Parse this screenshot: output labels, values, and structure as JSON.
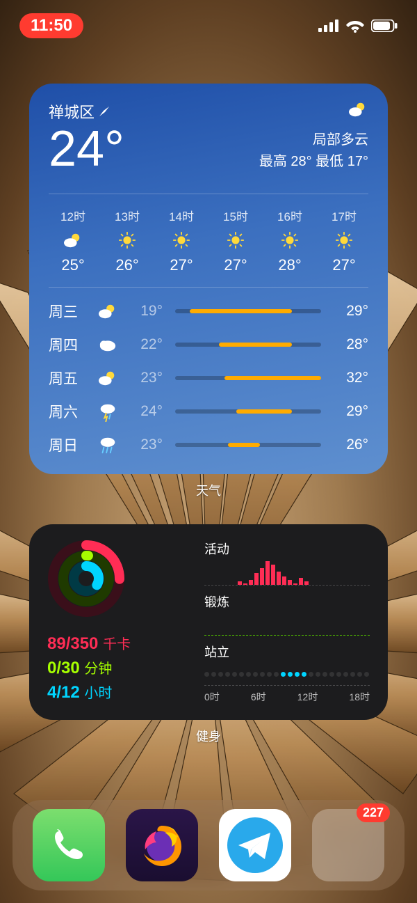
{
  "status": {
    "time": "11:50"
  },
  "weather_label": "天气",
  "fitness_label": "健身",
  "weather": {
    "location": "禅城区",
    "temp": "24°",
    "condition": "局部多云",
    "hilo": "最高 28° 最低 17°",
    "hourly": [
      {
        "h": "12时",
        "icon": "partly",
        "t": "25°"
      },
      {
        "h": "13时",
        "icon": "sun",
        "t": "26°"
      },
      {
        "h": "14时",
        "icon": "sun",
        "t": "27°"
      },
      {
        "h": "15时",
        "icon": "sun",
        "t": "27°"
      },
      {
        "h": "16时",
        "icon": "sun",
        "t": "28°"
      },
      {
        "h": "17时",
        "icon": "sun",
        "t": "27°"
      }
    ],
    "daily": [
      {
        "d": "周三",
        "icon": "partly",
        "lo": "19°",
        "hi": "29°",
        "off": 10,
        "len": 70
      },
      {
        "d": "周四",
        "icon": "cloud",
        "lo": "22°",
        "hi": "28°",
        "off": 30,
        "len": 50
      },
      {
        "d": "周五",
        "icon": "partly",
        "lo": "23°",
        "hi": "32°",
        "off": 34,
        "len": 66
      },
      {
        "d": "周六",
        "icon": "storm",
        "lo": "24°",
        "hi": "29°",
        "off": 42,
        "len": 38
      },
      {
        "d": "周日",
        "icon": "rain",
        "lo": "23°",
        "hi": "26°",
        "off": 36,
        "len": 22
      }
    ]
  },
  "fitness": {
    "move": {
      "val": "89/350",
      "unit": "千卡"
    },
    "exercise": {
      "val": "0/30",
      "unit": "分钟"
    },
    "stand": {
      "val": "4/12",
      "unit": "小时"
    },
    "sections": {
      "move": "活动",
      "exercise": "锻炼",
      "stand": "站立"
    },
    "move_bars": [
      0,
      0,
      0,
      0,
      0,
      0,
      4,
      2,
      6,
      14,
      20,
      28,
      24,
      16,
      10,
      6,
      2,
      8,
      4,
      0,
      0,
      0,
      0,
      0
    ],
    "stand_flags": [
      0,
      0,
      0,
      0,
      0,
      0,
      0,
      0,
      0,
      0,
      0,
      1,
      1,
      1,
      1,
      0,
      0,
      0,
      0,
      0,
      0,
      0,
      0,
      0
    ],
    "axis": [
      "0时",
      "6时",
      "12时",
      "18时"
    ]
  },
  "dock": {
    "badge": "227",
    "folder_colors": [
      "#0a7d3a",
      "#2e67b8",
      "#0aa0a0",
      "#5aa03c",
      "#888",
      "#888",
      "#888",
      "#888",
      "#888"
    ]
  }
}
